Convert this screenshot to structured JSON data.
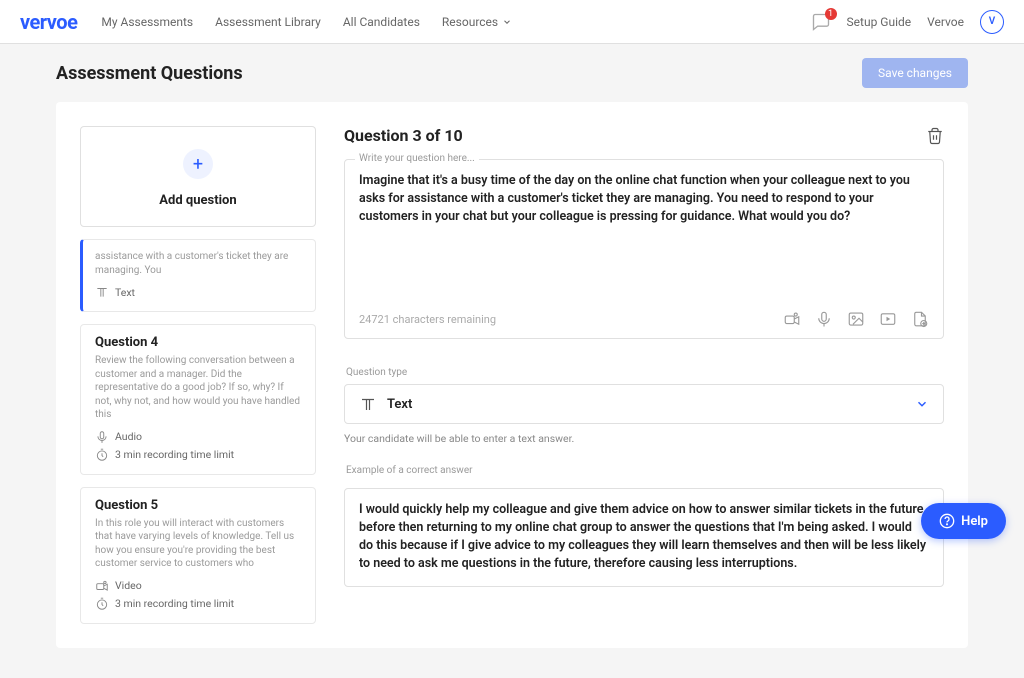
{
  "header": {
    "logo": "vervoe",
    "nav": [
      "My Assessments",
      "Assessment Library",
      "All Candidates",
      "Resources"
    ],
    "notif_count": "1",
    "setup_guide": "Setup Guide",
    "account_name": "Vervoe",
    "avatar_initial": "V"
  },
  "page": {
    "title": "Assessment Questions",
    "save_button": "Save changes"
  },
  "sidebar": {
    "add_question": "Add question",
    "active_snippet": "assistance with a customer's ticket they are managing. You",
    "active_type": "Text",
    "cards": [
      {
        "title": "Question 4",
        "desc": "Review the following conversation between a customer and a manager. Did the representative do a good job? If so, why? If not, why not, and how would you have handled this",
        "type": "Audio",
        "limit": "3 min recording time limit"
      },
      {
        "title": "Question 5",
        "desc": "In this role you will interact with customers that have varying levels of knowledge. Tell us how you ensure you're providing the best customer service to customers who",
        "type": "Video",
        "limit": "3 min recording time limit"
      }
    ]
  },
  "main": {
    "heading": "Question 3 of 10",
    "question_placeholder": "Write your question here...",
    "question_text": "Imagine that it's a busy time of the day on the online chat function when your colleague next to you asks for assistance with a customer's ticket they are managing. You need to respond to your customers in your chat but your colleague is pressing for guidance. What would you do?",
    "chars_remaining": "24721 characters remaining",
    "type_label": "Question type",
    "type_value": "Text",
    "type_helper": "Your candidate will be able to enter a text answer.",
    "example_label": "Example of a correct answer",
    "example_text": "I would quickly help my colleague and give them advice on how to answer similar tickets in the future before then returning to my online chat group to answer the questions that I'm being asked. I would do this because if I give advice to my colleagues they will learn themselves and then will be less likely to need to ask me questions in the future, therefore causing less interruptions."
  },
  "help_label": "Help"
}
